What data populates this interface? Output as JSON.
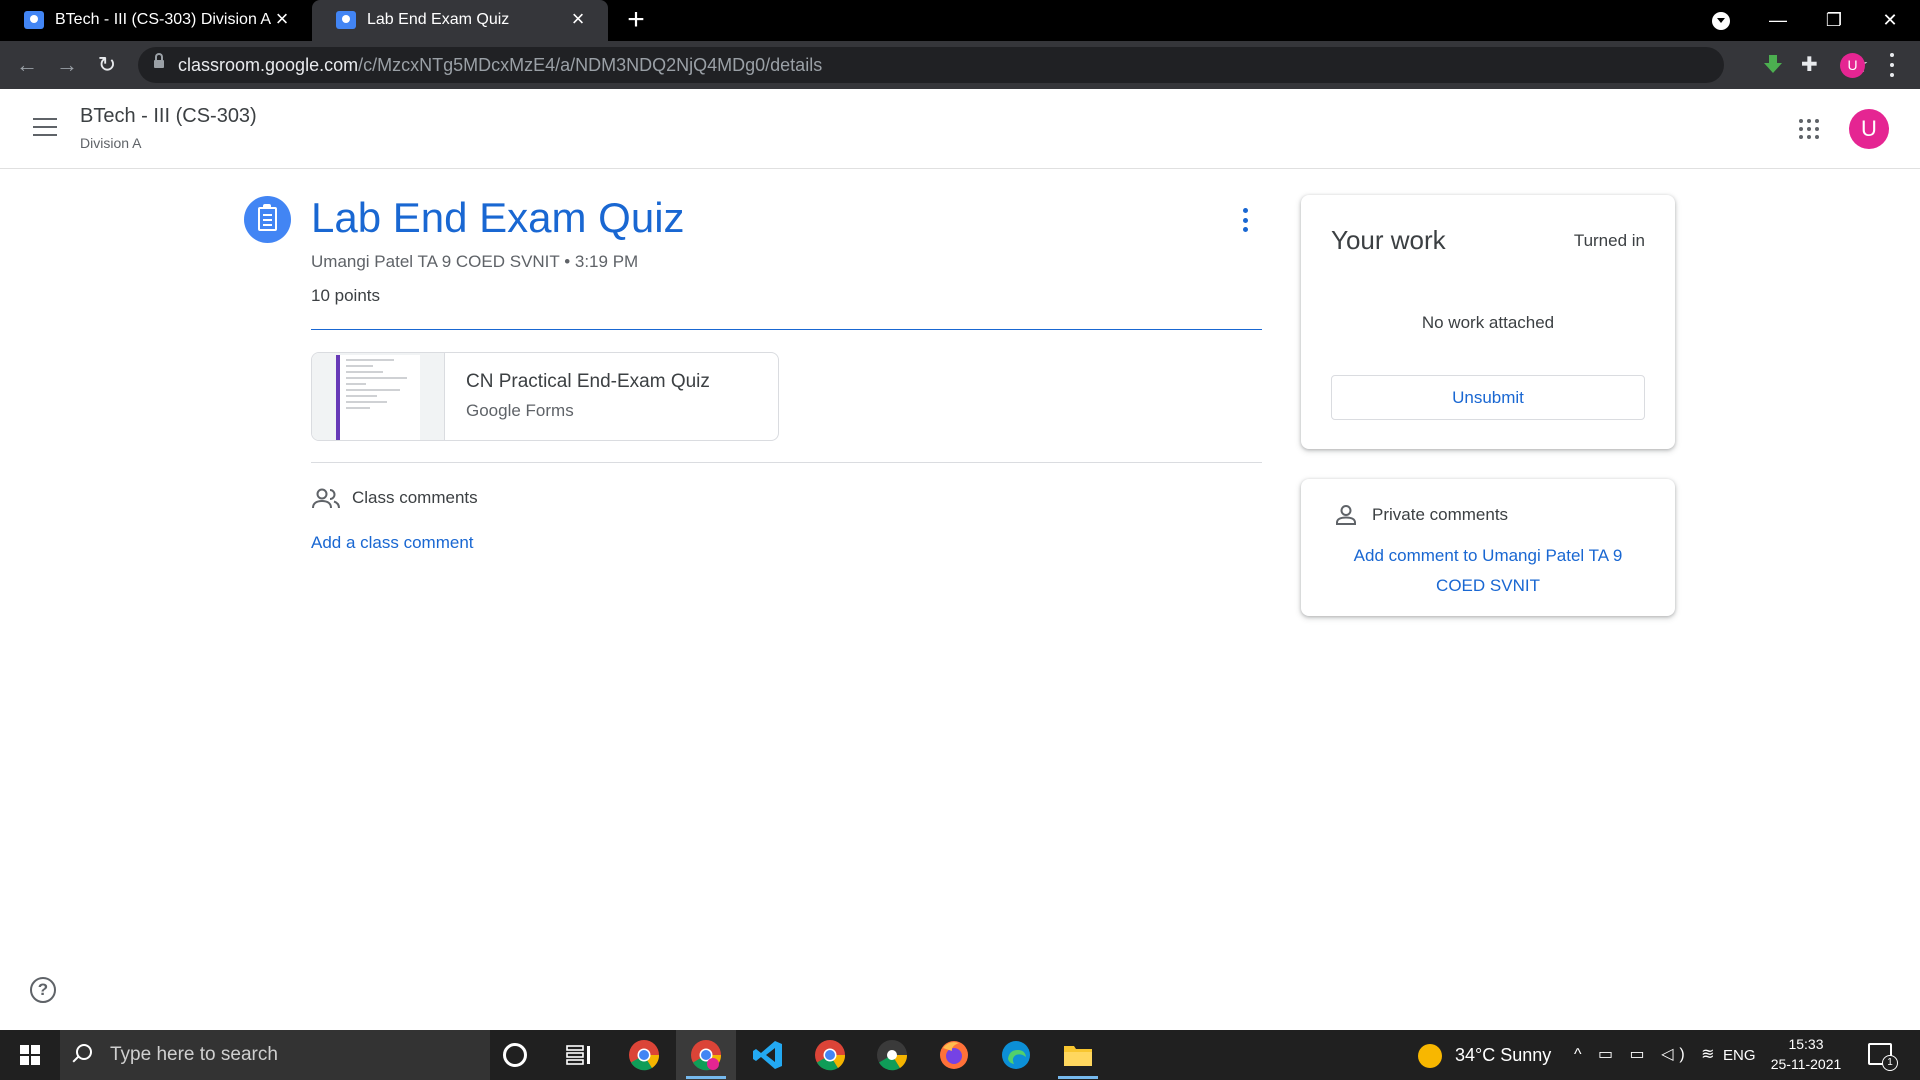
{
  "browser": {
    "tabs": [
      {
        "title": "BTech - III (CS-303) Division A",
        "active": false
      },
      {
        "title": "Lab End Exam Quiz",
        "active": true
      }
    ],
    "new_tab_label": "+",
    "url_host": "classroom.google.com",
    "url_path": "/c/MzcxNTg5MDcxMzE4/a/NDM3NDQ2NjQ4MDg0/details",
    "profile_initial": "U"
  },
  "header": {
    "course_title": "BTech - III (CS-303)",
    "course_subtitle": "Division A",
    "avatar_initial": "U"
  },
  "assignment": {
    "title": "Lab End Exam Quiz",
    "meta": "Umangi Patel TA 9 COED SVNIT • 3:19 PM",
    "points": "10 points",
    "attachment": {
      "title": "CN Practical End-Exam Quiz",
      "type": "Google Forms"
    },
    "class_comments_label": "Class comments",
    "add_class_comment": "Add a class comment"
  },
  "your_work": {
    "heading": "Your work",
    "status": "Turned in",
    "empty_text": "No work attached",
    "unsubmit_label": "Unsubmit"
  },
  "private_comments": {
    "label": "Private comments",
    "add_text": "Add comment to Umangi Patel TA 9 COED SVNIT"
  },
  "help_label": "?",
  "taskbar": {
    "search_placeholder": "Type here to search",
    "weather": "34°C  Sunny",
    "language": "ENG",
    "time": "15:33",
    "date": "25-11-2021",
    "notifications": "1",
    "icons": [
      "cortana-icon",
      "task-view-icon",
      "chrome-icon",
      "chrome-profile-icon",
      "vscode-icon",
      "chrome-alt-icon",
      "chrome-canary-icon",
      "firefox-icon",
      "edge-icon",
      "file-explorer-icon"
    ]
  },
  "colors": {
    "accent": "#1967d2",
    "icon_blue": "#4285f4",
    "avatar": "#e52592",
    "browser_bar": "#35363a"
  }
}
